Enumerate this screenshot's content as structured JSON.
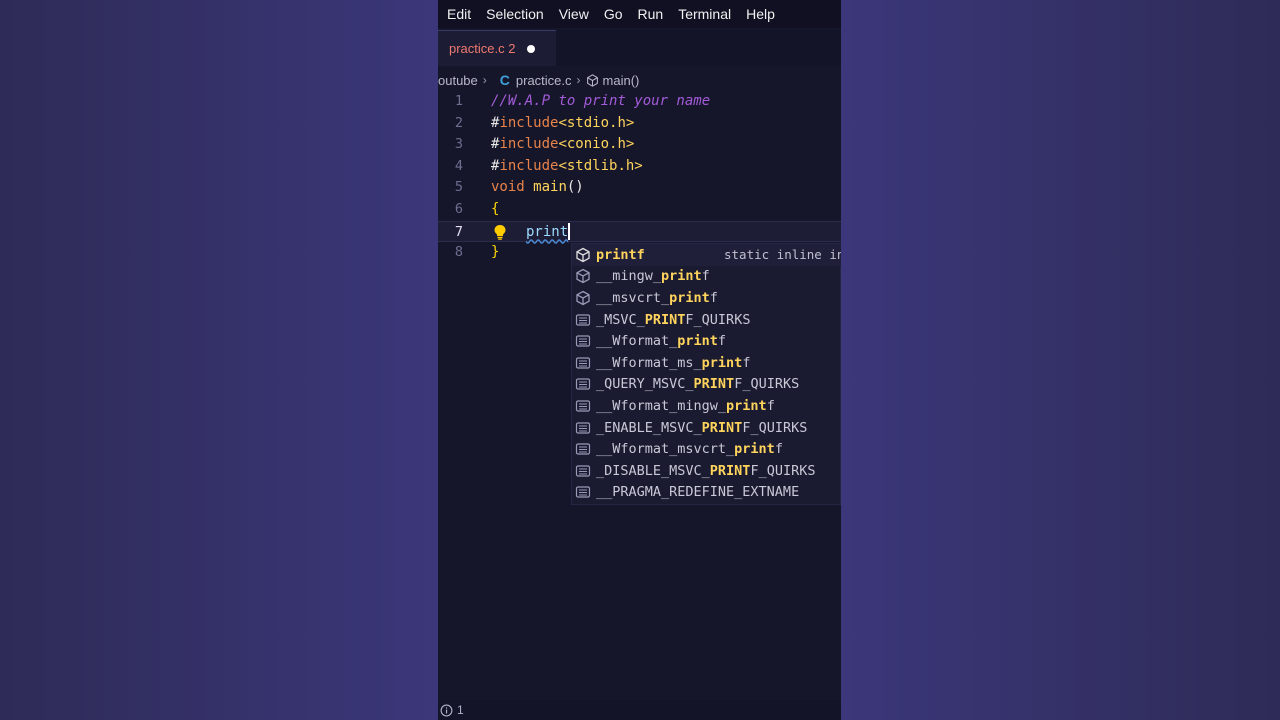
{
  "menu": [
    "Edit",
    "Selection",
    "View",
    "Go",
    "Run",
    "Terminal",
    "Help"
  ],
  "tab": {
    "label": "practice.c 2"
  },
  "breadcrumb": {
    "folder": "outube",
    "c_icon": "C",
    "file": "practice.c",
    "symbol": "main()"
  },
  "code": {
    "line_numbers": [
      "1",
      "2",
      "3",
      "4",
      "5",
      "6",
      "7",
      "8"
    ],
    "comment": "//W.A.P to print your name",
    "hash": "#",
    "include": "include",
    "headers": [
      "<stdio.h>",
      "<conio.h>",
      "<stdlib.h>"
    ],
    "void": "void",
    "main": "main",
    "parens": "()",
    "open_brace": "{",
    "typed": "print",
    "close_brace": "}"
  },
  "suggestions": {
    "items": [
      {
        "pre": "",
        "match": "print",
        "post": "f",
        "kind": "method",
        "full": "printf"
      },
      {
        "pre": "__mingw_",
        "match": "print",
        "post": "f",
        "kind": "method"
      },
      {
        "pre": "__msvcrt_",
        "match": "print",
        "post": "f",
        "kind": "method"
      },
      {
        "pre": "_MSVC_",
        "match": "PRINT",
        "post": "F_QUIRKS",
        "kind": "text"
      },
      {
        "pre": "__Wformat_",
        "match": "print",
        "post": "f",
        "kind": "text"
      },
      {
        "pre": "__Wformat_ms_",
        "match": "print",
        "post": "f",
        "kind": "text"
      },
      {
        "pre": "_QUERY_MSVC_",
        "match": "PRINT",
        "post": "F_QUIRKS",
        "kind": "text"
      },
      {
        "pre": "__Wformat_mingw_",
        "match": "print",
        "post": "f",
        "kind": "text"
      },
      {
        "pre": "_ENABLE_MSVC_",
        "match": "PRINT",
        "post": "F_QUIRKS",
        "kind": "text"
      },
      {
        "pre": "__Wformat_msvcrt_",
        "match": "print",
        "post": "f",
        "kind": "text"
      },
      {
        "pre": "_DISABLE_MSVC_",
        "match": "PRINT",
        "post": "F_QUIRKS",
        "kind": "text"
      },
      {
        "pre": "__PRAGMA_REDEFINE_EXTNAME",
        "match": "",
        "post": "",
        "kind": "text"
      }
    ],
    "detail": "static inline in"
  },
  "status": {
    "info_count": "1"
  },
  "colors": {
    "editor_bg": "#16162b",
    "accent_yellow": "#ffd45c",
    "keyword_orange": "#e8834a",
    "comment_purple": "#a35bd8"
  }
}
